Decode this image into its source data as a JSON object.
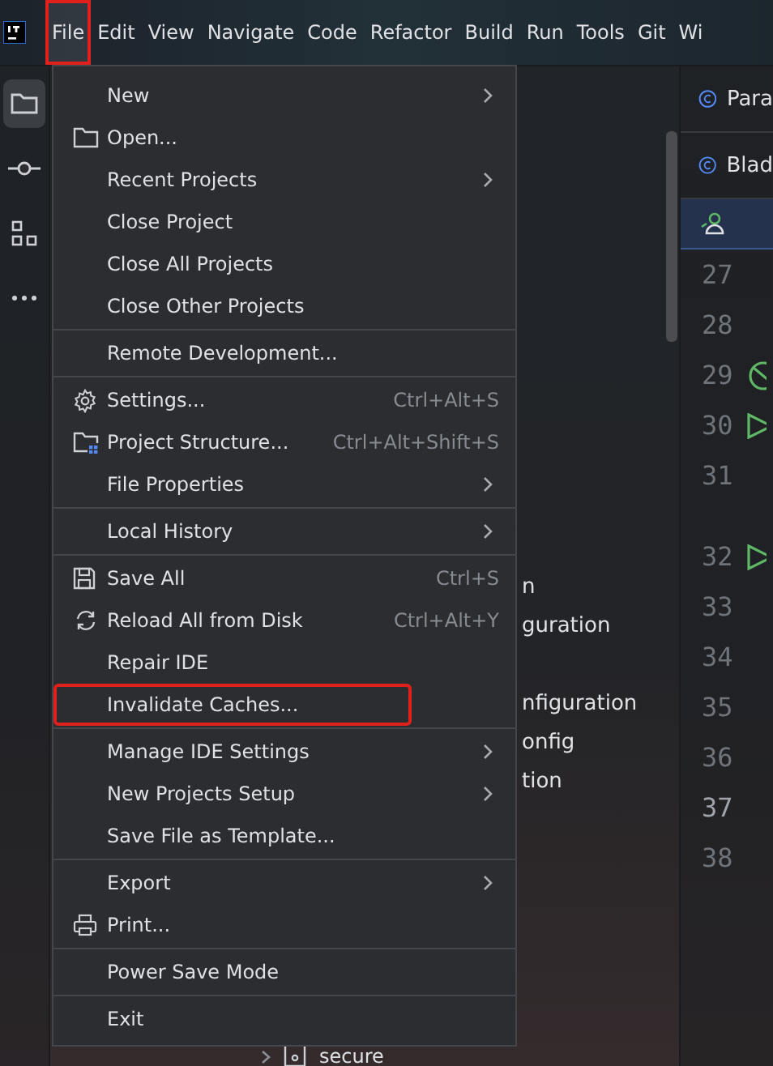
{
  "menubar": {
    "items": [
      {
        "label": "File",
        "selected": true,
        "highlighted": true
      },
      {
        "label": "Edit",
        "selected": false,
        "highlighted": false
      },
      {
        "label": "View",
        "selected": false,
        "highlighted": false
      },
      {
        "label": "Navigate",
        "selected": false,
        "highlighted": false
      },
      {
        "label": "Code",
        "selected": false,
        "highlighted": false
      },
      {
        "label": "Refactor",
        "selected": false,
        "highlighted": false
      },
      {
        "label": "Build",
        "selected": false,
        "highlighted": false
      },
      {
        "label": "Run",
        "selected": false,
        "highlighted": false
      },
      {
        "label": "Tools",
        "selected": false,
        "highlighted": false
      },
      {
        "label": "Git",
        "selected": false,
        "highlighted": false
      },
      {
        "label": "Wi",
        "selected": false,
        "highlighted": false
      }
    ]
  },
  "tool_strip": {
    "items": [
      {
        "kind": "folder",
        "selected": true
      },
      {
        "kind": "commit",
        "selected": false
      },
      {
        "kind": "structure",
        "selected": false
      },
      {
        "kind": "more",
        "selected": false
      }
    ]
  },
  "project_tree": {
    "rows": [
      {
        "text": "n"
      },
      {
        "text": "guration"
      },
      {
        "text": "nfiguration"
      },
      {
        "text": "onfig"
      },
      {
        "text": "tion"
      }
    ],
    "folder": {
      "label": "secure",
      "expanded": false
    }
  },
  "editor": {
    "tabs": [
      {
        "label": "Para",
        "selected": false
      },
      {
        "label": "Blad",
        "selected": false
      }
    ],
    "lines": [
      {
        "number": "27",
        "current": false,
        "kind": "plain",
        "gap_before": false
      },
      {
        "number": "28",
        "current": false,
        "kind": "plain",
        "gap_before": false
      },
      {
        "number": "29",
        "current": false,
        "kind": "disabled",
        "gap_before": false
      },
      {
        "number": "30",
        "current": false,
        "kind": "run",
        "gap_before": false
      },
      {
        "number": "31",
        "current": false,
        "kind": "plain",
        "gap_before": false
      },
      {
        "number": "32",
        "current": false,
        "kind": "run",
        "gap_before": true
      },
      {
        "number": "33",
        "current": false,
        "kind": "plain",
        "gap_before": false
      },
      {
        "number": "34",
        "current": false,
        "kind": "plain",
        "gap_before": false
      },
      {
        "number": "35",
        "current": false,
        "kind": "plain",
        "gap_before": false
      },
      {
        "number": "36",
        "current": false,
        "kind": "plain",
        "gap_before": false
      },
      {
        "number": "37",
        "current": true,
        "kind": "plain",
        "gap_before": false
      },
      {
        "number": "38",
        "current": false,
        "kind": "plain",
        "gap_before": false
      }
    ]
  },
  "file_menu": {
    "groups": [
      [
        {
          "label": "New",
          "kind": "plain",
          "submenu": true,
          "highlighted": false
        },
        {
          "label": "Open...",
          "kind": "folder",
          "submenu": false,
          "highlighted": false
        },
        {
          "label": "Recent Projects",
          "kind": "plain",
          "submenu": true,
          "highlighted": false
        },
        {
          "label": "Close Project",
          "kind": "plain",
          "submenu": false,
          "highlighted": false
        },
        {
          "label": "Close All Projects",
          "kind": "plain",
          "submenu": false,
          "highlighted": false
        },
        {
          "label": "Close Other Projects",
          "kind": "plain",
          "submenu": false,
          "highlighted": false
        }
      ],
      [
        {
          "label": "Remote Development...",
          "kind": "plain",
          "submenu": false,
          "highlighted": false
        }
      ],
      [
        {
          "label": "Settings...",
          "kind": "gear",
          "shortcut": "Ctrl+Alt+S",
          "submenu": false,
          "highlighted": false
        },
        {
          "label": "Project Structure...",
          "kind": "structure",
          "shortcut": "Ctrl+Alt+Shift+S",
          "submenu": false,
          "highlighted": false
        },
        {
          "label": "File Properties",
          "kind": "plain",
          "submenu": true,
          "highlighted": false
        }
      ],
      [
        {
          "label": "Local History",
          "kind": "plain",
          "submenu": true,
          "highlighted": false
        }
      ],
      [
        {
          "label": "Save All",
          "kind": "save",
          "shortcut": "Ctrl+S",
          "submenu": false,
          "highlighted": false
        },
        {
          "label": "Reload All from Disk",
          "kind": "reload",
          "shortcut": "Ctrl+Alt+Y",
          "submenu": false,
          "highlighted": false
        },
        {
          "label": "Repair IDE",
          "kind": "plain",
          "submenu": false,
          "highlighted": false
        },
        {
          "label": "Invalidate Caches...",
          "kind": "plain",
          "submenu": false,
          "highlighted": true
        }
      ],
      [
        {
          "label": "Manage IDE Settings",
          "kind": "plain",
          "submenu": true,
          "highlighted": false
        },
        {
          "label": "New Projects Setup",
          "kind": "plain",
          "submenu": true,
          "highlighted": false
        },
        {
          "label": "Save File as Template...",
          "kind": "plain",
          "submenu": false,
          "highlighted": false
        }
      ],
      [
        {
          "label": "Export",
          "kind": "plain",
          "submenu": true,
          "highlighted": false
        },
        {
          "label": "Print...",
          "kind": "print",
          "submenu": false,
          "highlighted": false
        }
      ],
      [
        {
          "label": "Power Save Mode",
          "kind": "plain",
          "submenu": false,
          "highlighted": false
        }
      ],
      [
        {
          "label": "Exit",
          "kind": "plain",
          "submenu": false,
          "highlighted": false
        }
      ]
    ]
  }
}
